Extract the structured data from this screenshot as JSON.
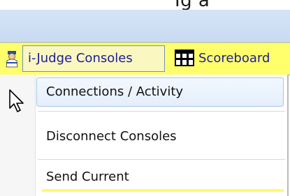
{
  "top_text": "Ig a",
  "menubar": {
    "ijudge_label": "i-Judge Consoles",
    "scoreboard_label": "Scoreboard"
  },
  "dropdown": {
    "items": [
      {
        "label": "Connections / Activity"
      },
      {
        "label": "Disconnect Consoles"
      },
      {
        "label": "Send Current"
      }
    ]
  },
  "icons": {
    "ijudge": "person-icon",
    "scoreboard": "scoreboard-icon",
    "cursor": "mouse-pointer-icon"
  },
  "colors": {
    "menubar_bg": "#ffff6b",
    "menu_text": "#1c1c9a",
    "band_bg": "#c9dbf2",
    "hover_bg": "#e4eefb",
    "accent_underline": "#fffb6b"
  }
}
